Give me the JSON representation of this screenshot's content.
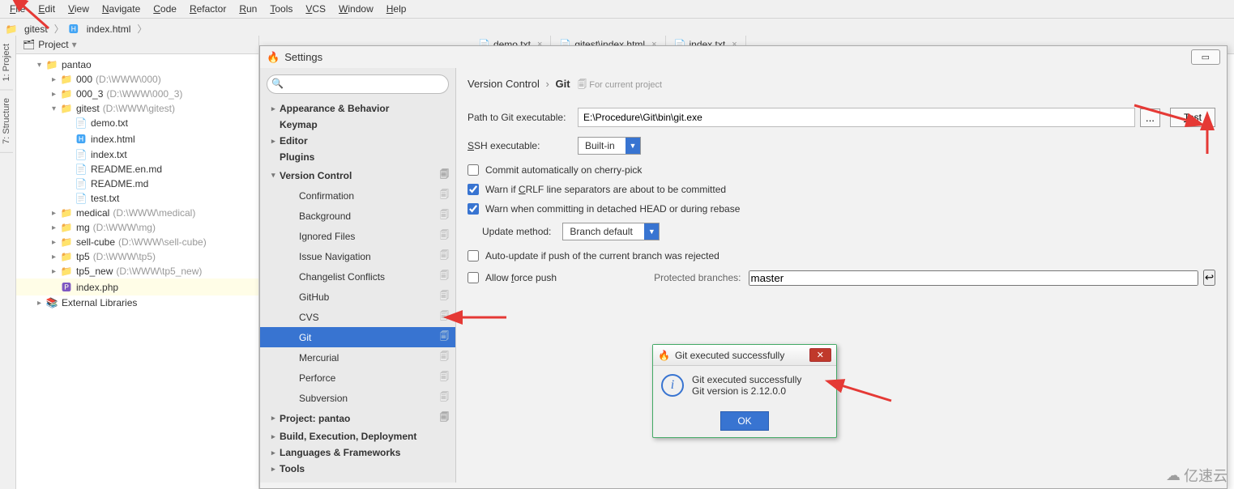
{
  "menubar": [
    "File",
    "Edit",
    "View",
    "Navigate",
    "Code",
    "Refactor",
    "Run",
    "Tools",
    "VCS",
    "Window",
    "Help"
  ],
  "breadcrumb": {
    "root": "gitest",
    "file": "index.html"
  },
  "sidetabs": [
    "1: Project",
    "7: Structure"
  ],
  "project": {
    "header": "Project",
    "tree": [
      {
        "lv": 0,
        "arrow": "▾",
        "icon": "folder-green",
        "label": "pantao",
        "hint": ""
      },
      {
        "lv": 1,
        "arrow": "▸",
        "icon": "folder",
        "label": "000",
        "hint": "(D:\\WWW\\000)"
      },
      {
        "lv": 1,
        "arrow": "▸",
        "icon": "folder",
        "label": "000_3",
        "hint": "(D:\\WWW\\000_3)"
      },
      {
        "lv": 1,
        "arrow": "▾",
        "icon": "folder",
        "label": "gitest",
        "hint": "(D:\\WWW\\gitest)",
        "sel": false
      },
      {
        "lv": 2,
        "arrow": "",
        "icon": "file",
        "label": "demo.txt",
        "hint": ""
      },
      {
        "lv": 2,
        "arrow": "",
        "icon": "html",
        "label": "index.html",
        "hint": ""
      },
      {
        "lv": 2,
        "arrow": "",
        "icon": "file",
        "label": "index.txt",
        "hint": ""
      },
      {
        "lv": 2,
        "arrow": "",
        "icon": "file",
        "label": "README.en.md",
        "hint": ""
      },
      {
        "lv": 2,
        "arrow": "",
        "icon": "file",
        "label": "README.md",
        "hint": ""
      },
      {
        "lv": 2,
        "arrow": "",
        "icon": "file",
        "label": "test.txt",
        "hint": ""
      },
      {
        "lv": 1,
        "arrow": "▸",
        "icon": "folder",
        "label": "medical",
        "hint": "(D:\\WWW\\medical)"
      },
      {
        "lv": 1,
        "arrow": "▸",
        "icon": "folder",
        "label": "mg",
        "hint": "(D:\\WWW\\mg)"
      },
      {
        "lv": 1,
        "arrow": "▸",
        "icon": "folder",
        "label": "sell-cube",
        "hint": "(D:\\WWW\\sell-cube)"
      },
      {
        "lv": 1,
        "arrow": "▸",
        "icon": "folder",
        "label": "tp5",
        "hint": "(D:\\WWW\\tp5)"
      },
      {
        "lv": 1,
        "arrow": "▸",
        "icon": "folder",
        "label": "tp5_new",
        "hint": "(D:\\WWW\\tp5_new)"
      },
      {
        "lv": 1,
        "arrow": "",
        "icon": "php",
        "label": "index.php",
        "hint": "",
        "sel": true
      },
      {
        "lv": 0,
        "arrow": "▸",
        "icon": "lib",
        "label": "External Libraries",
        "hint": ""
      }
    ]
  },
  "editor_tabs": [
    {
      "label": "demo.txt",
      "icon": "file"
    },
    {
      "label": "gitest\\index.html",
      "icon": "html"
    },
    {
      "label": "index.txt",
      "icon": "file"
    }
  ],
  "settings": {
    "title": "Settings",
    "search_placeholder": "",
    "tree": [
      {
        "lv": 0,
        "arrow": "▸",
        "bold": true,
        "label": "Appearance & Behavior"
      },
      {
        "lv": 0,
        "arrow": "",
        "bold": true,
        "label": "Keymap"
      },
      {
        "lv": 0,
        "arrow": "▸",
        "bold": true,
        "label": "Editor"
      },
      {
        "lv": 0,
        "arrow": "",
        "bold": true,
        "label": "Plugins"
      },
      {
        "lv": 0,
        "arrow": "▾",
        "bold": true,
        "label": "Version Control",
        "copy": true
      },
      {
        "lv": 1,
        "label": "Confirmation",
        "copy": true
      },
      {
        "lv": 1,
        "label": "Background",
        "copy": true
      },
      {
        "lv": 1,
        "label": "Ignored Files",
        "copy": true
      },
      {
        "lv": 1,
        "label": "Issue Navigation",
        "copy": true
      },
      {
        "lv": 1,
        "label": "Changelist Conflicts",
        "copy": true
      },
      {
        "lv": 1,
        "label": "GitHub",
        "copy": true
      },
      {
        "lv": 1,
        "label": "CVS",
        "copy": true
      },
      {
        "lv": 1,
        "label": "Git",
        "copy": true,
        "selected": true
      },
      {
        "lv": 1,
        "label": "Mercurial",
        "copy": true
      },
      {
        "lv": 1,
        "label": "Perforce",
        "copy": true
      },
      {
        "lv": 1,
        "label": "Subversion",
        "copy": true
      },
      {
        "lv": 0,
        "arrow": "▸",
        "bold": true,
        "label": "Project: pantao",
        "copy": true
      },
      {
        "lv": 0,
        "arrow": "▸",
        "bold": true,
        "label": "Build, Execution, Deployment"
      },
      {
        "lv": 0,
        "arrow": "▸",
        "bold": true,
        "label": "Languages & Frameworks"
      },
      {
        "lv": 0,
        "arrow": "▸",
        "bold": true,
        "label": "Tools"
      }
    ],
    "bc": {
      "a": "Version Control",
      "b": "Git",
      "hint": "For current project"
    },
    "form": {
      "path_label": "Path to Git executable:",
      "path_value": "E:\\Procedure\\Git\\bin\\git.exe",
      "browse": "...",
      "test": "Test",
      "ssh_label": "SSH executable:",
      "ssh_value": "Built-in",
      "cb_cherry": "Commit automatically on cherry-pick",
      "cb_crlf": "Warn if CRLF line separators are about to be committed",
      "cb_detached": "Warn when committing in detached HEAD or during rebase",
      "update_label": "Update method:",
      "update_value": "Branch default",
      "cb_autoupdate": "Auto-update if push of the current branch was rejected",
      "cb_force": "Allow force push",
      "protected_label": "Protected branches:",
      "protected_value": "master"
    }
  },
  "popup": {
    "title": "Git executed successfully",
    "line1": "Git executed successfully",
    "line2": "Git version is 2.12.0.0",
    "ok": "OK"
  },
  "watermark": "亿速云"
}
